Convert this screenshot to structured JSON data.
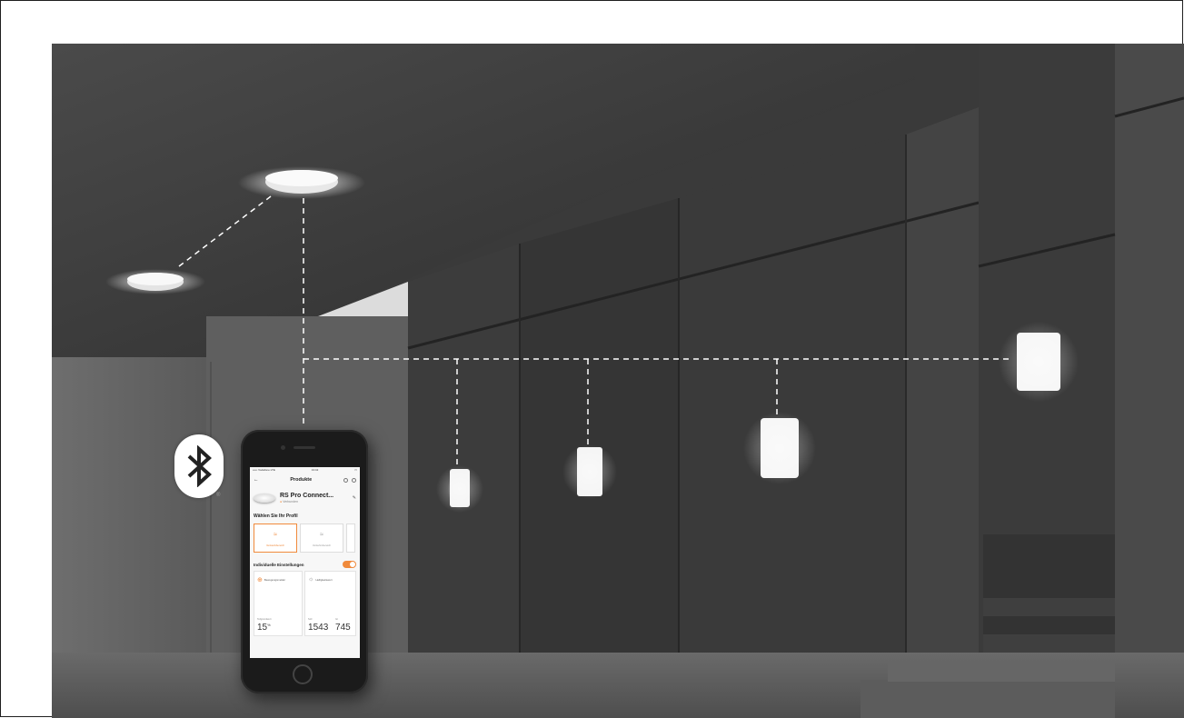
{
  "phone_app": {
    "status_bar": {
      "carrier": "••••• Vodafone LTE",
      "time": "13:42"
    },
    "nav_title": "Produkte",
    "device": {
      "name": "RS Pro Connect...",
      "status": "Verbunden"
    },
    "profile_heading": "Wählen Sie Ihr Profil",
    "profiles": [
      {
        "label": "Verkaufsbereich",
        "selected": true
      },
      {
        "label": "Verkehrsbereich",
        "selected": false
      }
    ],
    "individual_heading": "Individuelle Einstellungen",
    "toggle_on": true,
    "cards": [
      {
        "label": "Bewegungsmelder",
        "sub_label": "Teilgrundwert",
        "value": "15",
        "unit": "%"
      },
      {
        "label": "Helligkeitswert",
        "sub_labels": [
          "Soll",
          "Ist"
        ],
        "values": [
          "1543",
          "745"
        ]
      }
    ]
  },
  "bluetooth_badge": {
    "icon": "bluetooth-icon",
    "mark": "®"
  },
  "colors": {
    "accent": "#f08a3c",
    "concrete": "#3a3a3a"
  }
}
